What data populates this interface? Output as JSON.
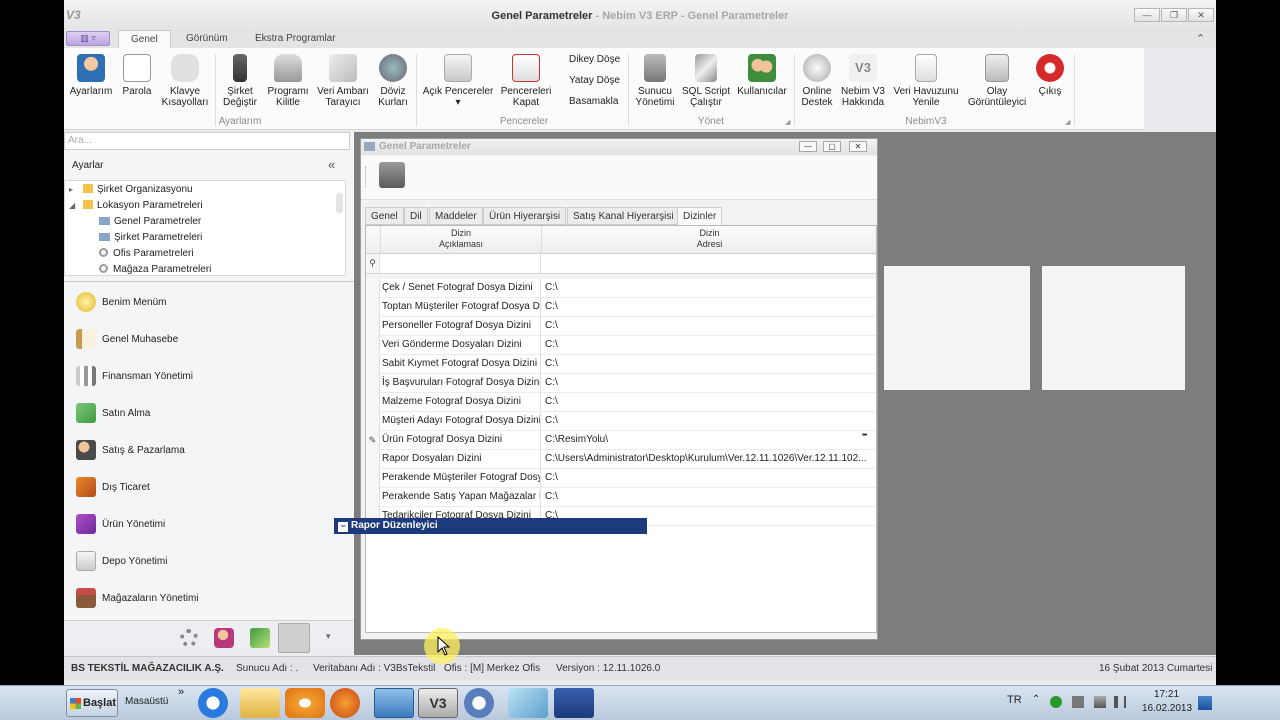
{
  "window": {
    "app_logo": "V3",
    "title_main": "Genel Parametreler",
    "title_suffix": " - Nebim V3 ERP - Genel Parametreler",
    "minimize": "—",
    "restore": "❐",
    "close": "✕",
    "collapse": "⌃"
  },
  "tabs": {
    "menu": "▥ ▿",
    "items": [
      "Genel",
      "Görünüm",
      "Ekstra Programlar"
    ]
  },
  "ribbon": {
    "ayarlar": [
      "Ayarlarım",
      "Parola",
      "Klavye\nKısayolları",
      "Şirket\nDeğiştir",
      "Programı\nKilitle",
      "Veri Ambarı\nTarayıcı",
      "Döviz\nKurları"
    ],
    "pencereler": [
      "Açık Pencereler",
      "Pencereleri\nKapat"
    ],
    "pencereler_small": [
      "Dikey Döşe",
      "Yatay Döşe",
      "Basamakla"
    ],
    "yonet": [
      "Sunucu\nYönetimi",
      "SQL Script\nÇalıştır",
      "Kullanıcılar"
    ],
    "nebim": [
      "Online\nDestek",
      "Nebim V3\nHakkında",
      "Veri Havuzunu\nYenile",
      "Olay\nGörüntüleyici",
      "Çıkış"
    ],
    "groups": [
      "Ayarlarım",
      "Pencereler",
      "Yönet",
      "NebimV3"
    ],
    "dropdown_arrow": "▾",
    "launcher": "◢"
  },
  "sidebar": {
    "search_placeholder": "Ara...",
    "header": "Ayarlar",
    "collapse": "«",
    "tree": [
      {
        "label": "Şirket Organizasyonu",
        "expander": "▸"
      },
      {
        "label": "Lokasyon Parametreleri",
        "expander": "◢"
      },
      {
        "label": "Genel Parametreler",
        "expander": ""
      },
      {
        "label": "Şirket Parametreleri",
        "expander": ""
      },
      {
        "label": "Ofis Parametreleri",
        "expander": ""
      },
      {
        "label": "Mağaza Parametreleri",
        "expander": ""
      }
    ],
    "nav": [
      "Benim Menüm",
      "Genel Muhasebe",
      "Finansman Yönetimi",
      "Satın Alma",
      "Satış & Pazarlama",
      "Dış Ticaret",
      "Ürün Yönetimi",
      "Depo Yönetimi",
      "Mağazaların Yönetimi"
    ],
    "more": "▾"
  },
  "child": {
    "title": "Genel Parametreler",
    "min": "—",
    "max": "▢",
    "close": "✕",
    "subtabs": [
      "Genel",
      "Dil",
      "Maddeler",
      "Ürün Hiyerarşisi",
      "Satış Kanal Hiyerarşisi",
      "Dizinler"
    ],
    "col1": "Dizin\nAçıklaması",
    "col2": "Dizin\nAdresi",
    "filter_icon": "⚲",
    "edit_icon": "✎",
    "ellipsis": "•••",
    "rows": [
      {
        "desc": "Çek / Senet Fotograf Dosya Dizini",
        "path": "C:\\"
      },
      {
        "desc": "Toptan Müşteriler Fotograf Dosya Dizini",
        "path": "C:\\"
      },
      {
        "desc": "Personeller Fotograf Dosya Dizini",
        "path": "C:\\"
      },
      {
        "desc": "Veri Gönderme Dosyaları Dizini",
        "path": "C:\\"
      },
      {
        "desc": "Sabit Kıymet Fotograf Dosya Dizini",
        "path": "C:\\"
      },
      {
        "desc": "İş Başvuruları Fotograf Dosya Dizini",
        "path": "C:\\"
      },
      {
        "desc": "Malzeme Fotograf Dosya Dizini",
        "path": "C:\\"
      },
      {
        "desc": "Müşteri Adayı Fotograf Dosya Dizini",
        "path": "C:\\"
      },
      {
        "desc": "Ürün Fotograf Dosya Dizini",
        "path": "C:\\ResimYolu\\"
      },
      {
        "desc": "Rapor Dosyaları Dizini",
        "path": "C:\\Users\\Administrator\\Desktop\\Kurulum\\Ver.12.11.1026\\Ver.12.11.102..."
      },
      {
        "desc": "Perakende Müşteriler Fotograf Dosya Dizini",
        "path": "C:\\"
      },
      {
        "desc": "Perakende Satış Yapan Mağazalar Fotograf",
        "path": "C:\\"
      },
      {
        "desc": "Tedarikçiler Fotograf Dosya Dizini",
        "path": "C:\\"
      }
    ]
  },
  "rapor": {
    "title": "Rapor Düzenleyici",
    "minus": "−"
  },
  "status": {
    "company": "BS TEKSTİL MAĞAZACILIK A.Ş.",
    "server": "Sunucu Adı : .",
    "db": "Veritabanı Adı : V3BsTekstil",
    "office": "Ofis : [M]  Merkez Ofis",
    "version": "Versiyon : 12.11.1026.0",
    "date": "16 Şubat 2013 Cumartesi"
  },
  "taskbar": {
    "start": "Başlat",
    "desktop": "Masaüstü",
    "chevron": "»",
    "lang": "TR",
    "tray_up": "⌃",
    "time": "17:21",
    "date": "16.02.2013"
  },
  "colors": {
    "accent": "#1d3a7e",
    "mdi_bg": "#7d7d7d"
  }
}
